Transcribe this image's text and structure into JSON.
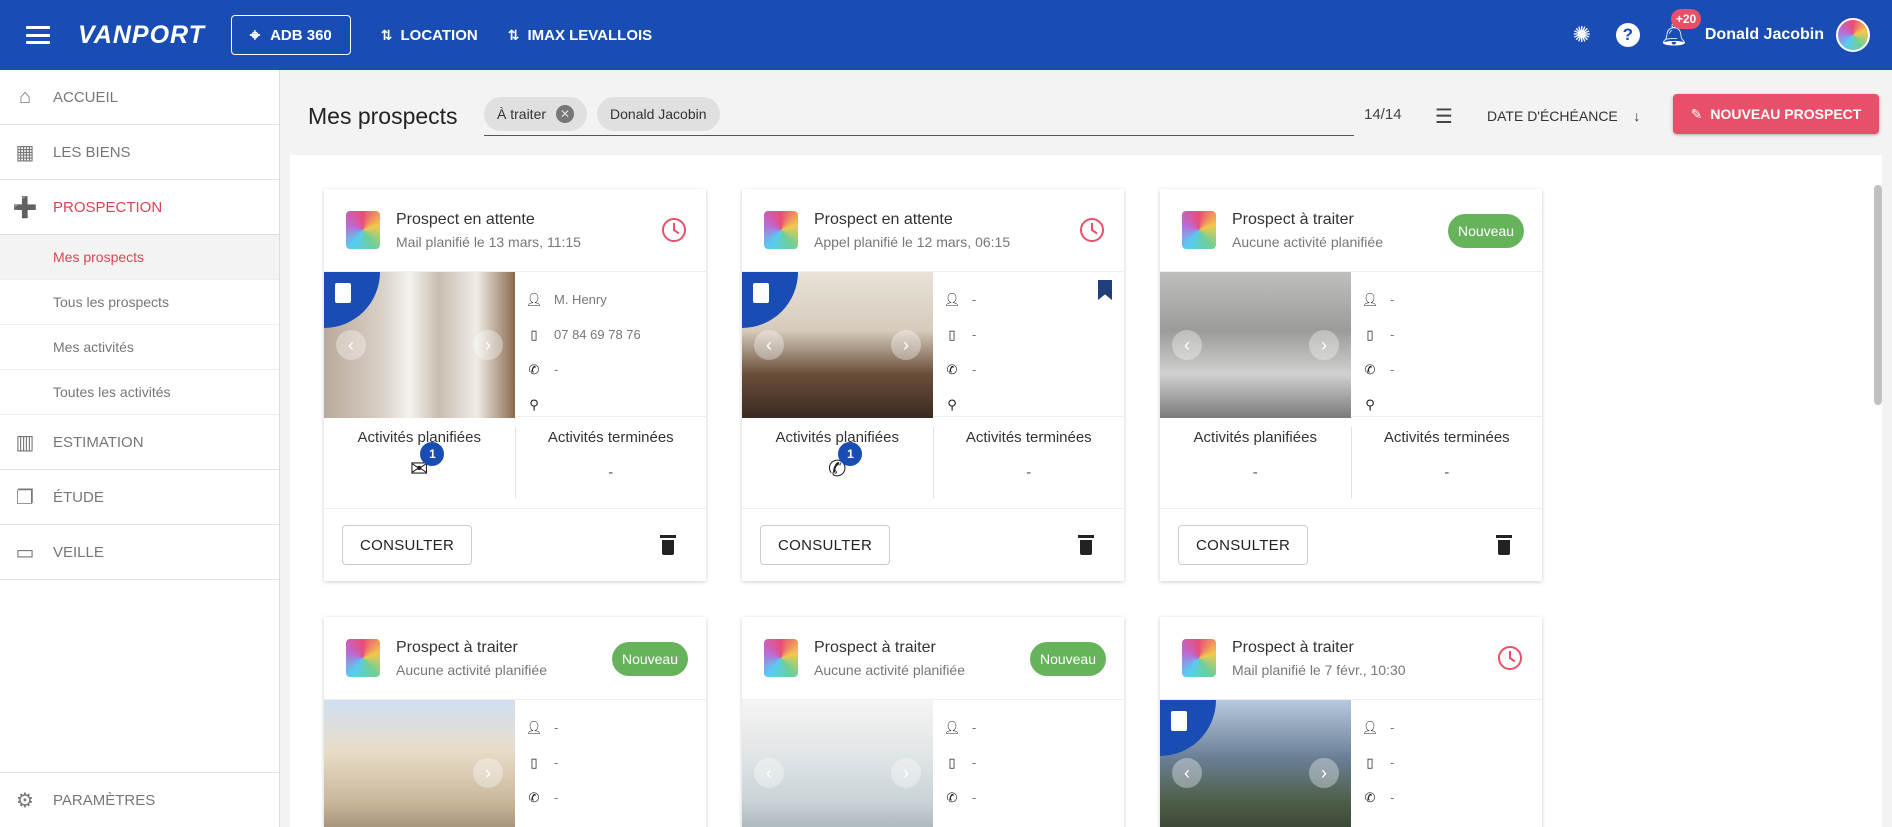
{
  "topbar": {
    "logo": "VANPORT",
    "adb_button": "ADB 360",
    "location_link": "LOCATION",
    "agency_link": "IMAX LEVALLOIS",
    "notif_count": "+20",
    "user_name": "Donald Jacobin"
  },
  "sidebar": {
    "items": [
      {
        "label": "ACCUEIL",
        "icon": "home-icon"
      },
      {
        "label": "LES BIENS",
        "icon": "building-icon"
      },
      {
        "label": "PROSPECTION",
        "icon": "person-add-icon"
      }
    ],
    "subitems": [
      {
        "label": "Mes prospects"
      },
      {
        "label": "Tous les prospects"
      },
      {
        "label": "Mes activités"
      },
      {
        "label": "Toutes les activités"
      }
    ],
    "items2": [
      {
        "label": "ESTIMATION",
        "icon": "bar-chart-icon"
      },
      {
        "label": "ÉTUDE",
        "icon": "library-icon"
      },
      {
        "label": "VEILLE",
        "icon": "cast-icon"
      }
    ],
    "settings": "PARAMÈTRES"
  },
  "main": {
    "title": "Mes prospects",
    "chips": [
      "À traiter",
      "Donald Jacobin"
    ],
    "count": "14/14",
    "sort_label": "DATE D'ÉCHÉANCE",
    "new_button": "NOUVEAU PROSPECT"
  },
  "labels": {
    "planned": "Activités planifiées",
    "done": "Activités terminées",
    "consult": "CONSULTER",
    "new_badge": "Nouveau",
    "dash": "-"
  },
  "cards": [
    {
      "title": "Prospect en attente",
      "subtitle": "Mail planifié le 13 mars, 11:15",
      "name": "M. Henry",
      "mobile": "07 84 69 78 76",
      "phone": "-",
      "planned_count": "1",
      "done": "-"
    },
    {
      "title": "Prospect en attente",
      "subtitle": "Appel planifié le 12 mars, 06:15",
      "name": "-",
      "mobile": "-",
      "phone": "-",
      "planned_count": "1",
      "done": "-"
    },
    {
      "title": "Prospect à traiter",
      "subtitle": "Aucune activité planifiée",
      "name": "-",
      "mobile": "-",
      "phone": "-",
      "planned": "-",
      "done": "-"
    },
    {
      "title": "Prospect à traiter",
      "subtitle": "Aucune activité planifiée",
      "name": "-",
      "mobile": "-",
      "phone": "-"
    },
    {
      "title": "Prospect à traiter",
      "subtitle": "Aucune activité planifiée",
      "name": "-",
      "mobile": "-",
      "phone": "-"
    },
    {
      "title": "Prospect à traiter",
      "subtitle": "Mail planifié le 7 févr., 10:30",
      "name": "-",
      "mobile": "-",
      "phone": "-"
    }
  ]
}
